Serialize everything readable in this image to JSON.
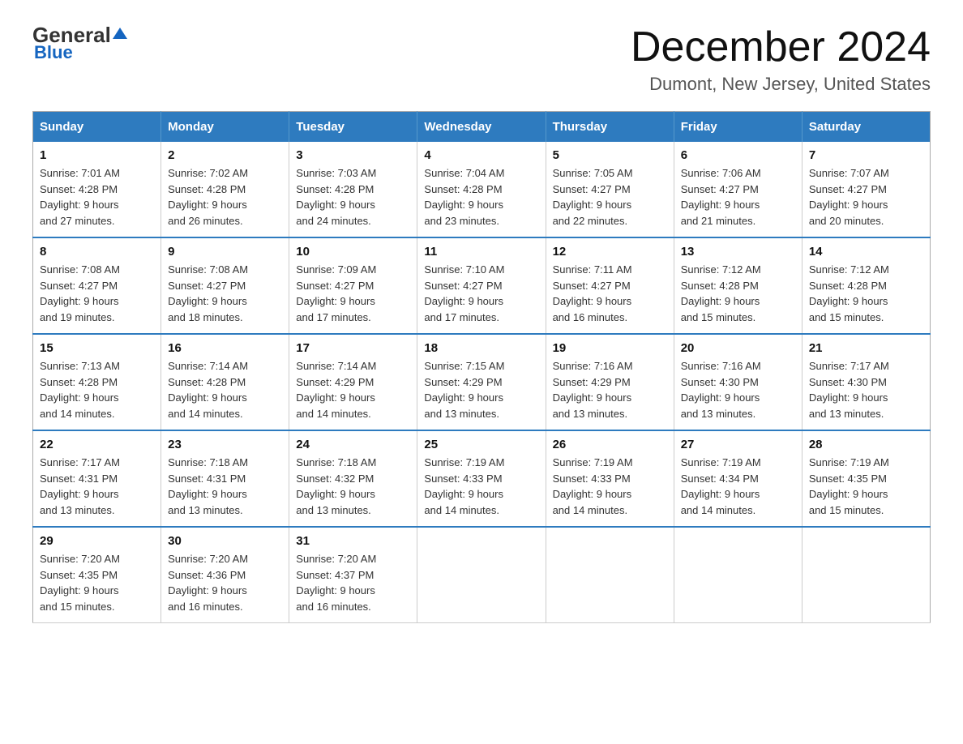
{
  "header": {
    "logo_general": "General",
    "logo_blue": "Blue",
    "title": "December 2024",
    "subtitle": "Dumont, New Jersey, United States"
  },
  "days_of_week": [
    "Sunday",
    "Monday",
    "Tuesday",
    "Wednesday",
    "Thursday",
    "Friday",
    "Saturday"
  ],
  "weeks": [
    [
      {
        "day": "1",
        "sunrise": "7:01 AM",
        "sunset": "4:28 PM",
        "daylight": "9 hours and 27 minutes."
      },
      {
        "day": "2",
        "sunrise": "7:02 AM",
        "sunset": "4:28 PM",
        "daylight": "9 hours and 26 minutes."
      },
      {
        "day": "3",
        "sunrise": "7:03 AM",
        "sunset": "4:28 PM",
        "daylight": "9 hours and 24 minutes."
      },
      {
        "day": "4",
        "sunrise": "7:04 AM",
        "sunset": "4:28 PM",
        "daylight": "9 hours and 23 minutes."
      },
      {
        "day": "5",
        "sunrise": "7:05 AM",
        "sunset": "4:27 PM",
        "daylight": "9 hours and 22 minutes."
      },
      {
        "day": "6",
        "sunrise": "7:06 AM",
        "sunset": "4:27 PM",
        "daylight": "9 hours and 21 minutes."
      },
      {
        "day": "7",
        "sunrise": "7:07 AM",
        "sunset": "4:27 PM",
        "daylight": "9 hours and 20 minutes."
      }
    ],
    [
      {
        "day": "8",
        "sunrise": "7:08 AM",
        "sunset": "4:27 PM",
        "daylight": "9 hours and 19 minutes."
      },
      {
        "day": "9",
        "sunrise": "7:08 AM",
        "sunset": "4:27 PM",
        "daylight": "9 hours and 18 minutes."
      },
      {
        "day": "10",
        "sunrise": "7:09 AM",
        "sunset": "4:27 PM",
        "daylight": "9 hours and 17 minutes."
      },
      {
        "day": "11",
        "sunrise": "7:10 AM",
        "sunset": "4:27 PM",
        "daylight": "9 hours and 17 minutes."
      },
      {
        "day": "12",
        "sunrise": "7:11 AM",
        "sunset": "4:27 PM",
        "daylight": "9 hours and 16 minutes."
      },
      {
        "day": "13",
        "sunrise": "7:12 AM",
        "sunset": "4:28 PM",
        "daylight": "9 hours and 15 minutes."
      },
      {
        "day": "14",
        "sunrise": "7:12 AM",
        "sunset": "4:28 PM",
        "daylight": "9 hours and 15 minutes."
      }
    ],
    [
      {
        "day": "15",
        "sunrise": "7:13 AM",
        "sunset": "4:28 PM",
        "daylight": "9 hours and 14 minutes."
      },
      {
        "day": "16",
        "sunrise": "7:14 AM",
        "sunset": "4:28 PM",
        "daylight": "9 hours and 14 minutes."
      },
      {
        "day": "17",
        "sunrise": "7:14 AM",
        "sunset": "4:29 PM",
        "daylight": "9 hours and 14 minutes."
      },
      {
        "day": "18",
        "sunrise": "7:15 AM",
        "sunset": "4:29 PM",
        "daylight": "9 hours and 13 minutes."
      },
      {
        "day": "19",
        "sunrise": "7:16 AM",
        "sunset": "4:29 PM",
        "daylight": "9 hours and 13 minutes."
      },
      {
        "day": "20",
        "sunrise": "7:16 AM",
        "sunset": "4:30 PM",
        "daylight": "9 hours and 13 minutes."
      },
      {
        "day": "21",
        "sunrise": "7:17 AM",
        "sunset": "4:30 PM",
        "daylight": "9 hours and 13 minutes."
      }
    ],
    [
      {
        "day": "22",
        "sunrise": "7:17 AM",
        "sunset": "4:31 PM",
        "daylight": "9 hours and 13 minutes."
      },
      {
        "day": "23",
        "sunrise": "7:18 AM",
        "sunset": "4:31 PM",
        "daylight": "9 hours and 13 minutes."
      },
      {
        "day": "24",
        "sunrise": "7:18 AM",
        "sunset": "4:32 PM",
        "daylight": "9 hours and 13 minutes."
      },
      {
        "day": "25",
        "sunrise": "7:19 AM",
        "sunset": "4:33 PM",
        "daylight": "9 hours and 14 minutes."
      },
      {
        "day": "26",
        "sunrise": "7:19 AM",
        "sunset": "4:33 PM",
        "daylight": "9 hours and 14 minutes."
      },
      {
        "day": "27",
        "sunrise": "7:19 AM",
        "sunset": "4:34 PM",
        "daylight": "9 hours and 14 minutes."
      },
      {
        "day": "28",
        "sunrise": "7:19 AM",
        "sunset": "4:35 PM",
        "daylight": "9 hours and 15 minutes."
      }
    ],
    [
      {
        "day": "29",
        "sunrise": "7:20 AM",
        "sunset": "4:35 PM",
        "daylight": "9 hours and 15 minutes."
      },
      {
        "day": "30",
        "sunrise": "7:20 AM",
        "sunset": "4:36 PM",
        "daylight": "9 hours and 16 minutes."
      },
      {
        "day": "31",
        "sunrise": "7:20 AM",
        "sunset": "4:37 PM",
        "daylight": "9 hours and 16 minutes."
      },
      null,
      null,
      null,
      null
    ]
  ],
  "labels": {
    "sunrise": "Sunrise:",
    "sunset": "Sunset:",
    "daylight": "Daylight:"
  }
}
